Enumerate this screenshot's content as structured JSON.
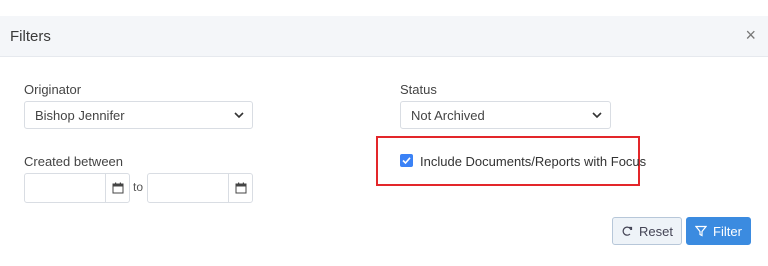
{
  "dialog": {
    "title": "Filters",
    "close_icon": "×"
  },
  "originator": {
    "label": "Originator",
    "value": "Bishop Jennifer"
  },
  "status": {
    "label": "Status",
    "value": "Not Archived"
  },
  "created_between": {
    "label": "Created between",
    "to_text": "to",
    "from_value": "",
    "to_value": ""
  },
  "include_focus": {
    "label": "Include Documents/Reports with Focus",
    "checked": true
  },
  "buttons": {
    "reset": "Reset",
    "filter": "Filter"
  },
  "colors": {
    "accent": "#3b8be0",
    "highlight": "#e3262a"
  }
}
